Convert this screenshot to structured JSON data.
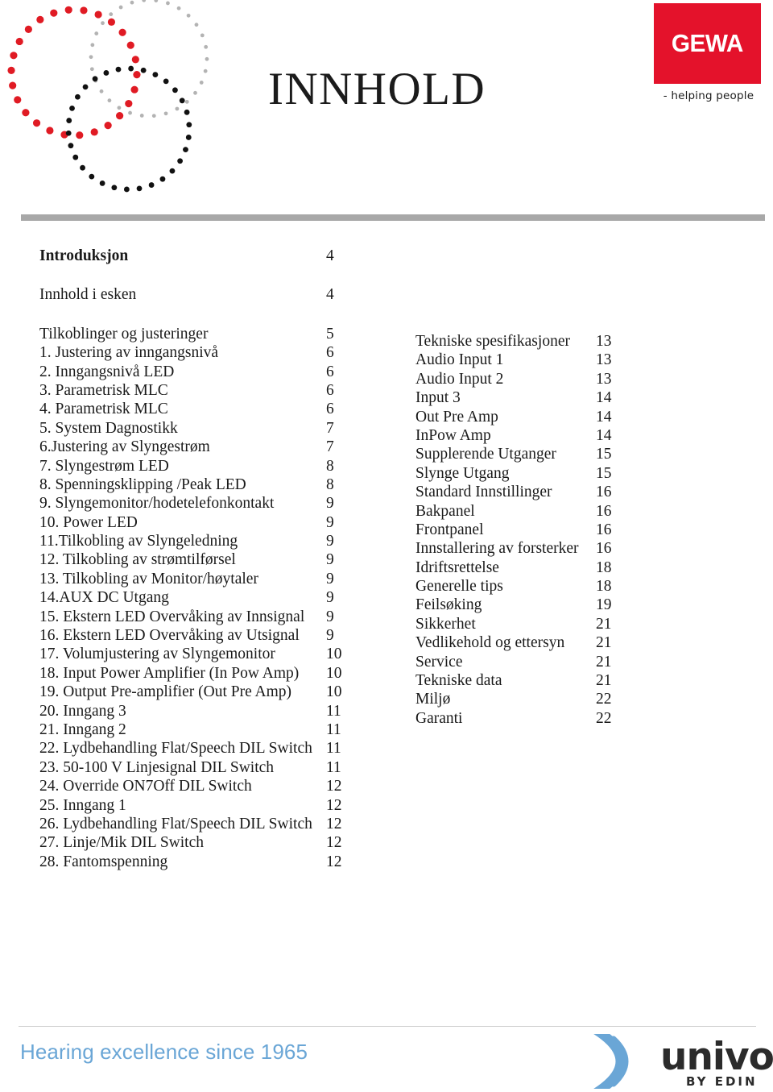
{
  "header": {
    "title": "INNHOLD",
    "logo": {
      "wordmark": "GEWA",
      "tagline": "- helping people",
      "brand_color": "#e4122b"
    }
  },
  "decoration": {
    "name": "dotted-circles",
    "colors": {
      "red": "#e01b24",
      "gray": "#b3b3b3",
      "black": "#111111"
    }
  },
  "toc": {
    "left_column": [
      {
        "label": "Introduksjon",
        "page": "4",
        "bold": true,
        "gap": true
      },
      {
        "label": "Innhold i esken",
        "page": "4",
        "bold": false,
        "gap": true
      },
      {
        "label": "Tilkoblinger og justeringer",
        "page": "5",
        "bold": false
      },
      {
        "label": "1. Justering av inngangsnivå",
        "page": "6",
        "bold": false
      },
      {
        "label": "2. Inngangsnivå LED",
        "page": "6",
        "bold": false
      },
      {
        "label": "3. Parametrisk MLC",
        "page": "6",
        "bold": false
      },
      {
        "label": "4. Parametrisk MLC",
        "page": "6",
        "bold": false
      },
      {
        "label": "5. System Dagnostikk",
        "page": "7",
        "bold": false
      },
      {
        "label": "6.Justering av Slyngestrøm",
        "page": "7",
        "bold": false
      },
      {
        "label": "7. Slyngestrøm LED",
        "page": "8",
        "bold": false
      },
      {
        "label": "8. Spenningsklipping /Peak LED",
        "page": "8",
        "bold": false
      },
      {
        "label": "9. Slyngemonitor/hodetelefonkontakt",
        "page": "9",
        "bold": false
      },
      {
        "label": "10. Power LED",
        "page": "9",
        "bold": false
      },
      {
        "label": "11.Tilkobling av Slyngeledning",
        "page": "9",
        "bold": false
      },
      {
        "label": "12. Tilkobling av strømtilførsel",
        "page": "9",
        "bold": false
      },
      {
        "label": "13. Tilkobling av Monitor/høytaler",
        "page": "9",
        "bold": false
      },
      {
        "label": "14.AUX DC Utgang",
        "page": "9",
        "bold": false
      },
      {
        "label": "15. Ekstern LED Overvåking av Innsignal",
        "page": "9",
        "bold": false
      },
      {
        "label": "16. Ekstern LED Overvåking av Utsignal",
        "page": "9",
        "bold": false
      },
      {
        "label": "17. Volumjustering av Slyngemonitor",
        "page": "10",
        "bold": false
      },
      {
        "label": "18. Input Power Amplifier (In Pow Amp)",
        "page": "10",
        "bold": false
      },
      {
        "label": "19. Output Pre-amplifier (Out Pre Amp)",
        "page": "10",
        "bold": false
      },
      {
        "label": "20. Inngang 3",
        "page": "11",
        "bold": false
      },
      {
        "label": "21. Inngang 2",
        "page": "11",
        "bold": false
      },
      {
        "label": "22. Lydbehandling Flat/Speech DIL Switch",
        "page": "11",
        "bold": false
      },
      {
        "label": "23. 50-100 V Linjesignal DIL Switch",
        "page": "11",
        "bold": false
      },
      {
        "label": "24. Override ON7Off DIL Switch",
        "page": "12",
        "bold": false
      },
      {
        "label": "25. Inngang 1",
        "page": "12",
        "bold": false
      },
      {
        "label": "26. Lydbehandling Flat/Speech DIL Switch",
        "page": "12",
        "bold": false
      },
      {
        "label": "27. Linje/Mik DIL Switch",
        "page": "12",
        "bold": false
      },
      {
        "label": "28. Fantomspenning",
        "page": "12",
        "bold": false
      }
    ],
    "right_column": [
      {
        "label": "Tekniske spesifikasjoner",
        "page": "13"
      },
      {
        "label": "Audio Input 1",
        "page": "13"
      },
      {
        "label": "Audio Input 2",
        "page": "13"
      },
      {
        "label": "Input 3",
        "page": "14"
      },
      {
        "label": "Out Pre Amp",
        "page": "14"
      },
      {
        "label": "InPow Amp",
        "page": "14"
      },
      {
        "label": "Supplerende Utganger",
        "page": "15"
      },
      {
        "label": "Slynge Utgang",
        "page": "15"
      },
      {
        "label": "Standard Innstillinger",
        "page": "16"
      },
      {
        "label": "Bakpanel",
        "page": "16"
      },
      {
        "label": "Frontpanel",
        "page": "16"
      },
      {
        "label": "Innstallering av forsterker",
        "page": "16"
      },
      {
        "label": "Idriftsrettelse",
        "page": "18"
      },
      {
        "label": "Generelle tips",
        "page": "18"
      },
      {
        "label": "Feilsøking",
        "page": "19"
      },
      {
        "label": "Sikkerhet",
        "page": "21"
      },
      {
        "label": "Vedlikehold og ettersyn",
        "page": "21"
      },
      {
        "label": "Service",
        "page": "21"
      },
      {
        "label": "Tekniske data",
        "page": "21"
      },
      {
        "label": "Miljø",
        "page": "22"
      },
      {
        "label": "Garanti",
        "page": "22"
      }
    ]
  },
  "footer": {
    "tagline": "Hearing excellence since 1965",
    "tagline_color": "#6aa6d6",
    "logo": {
      "wordmark": "univox",
      "sub": "BY EDIN",
      "wave_color": "#6aa6d6"
    }
  }
}
